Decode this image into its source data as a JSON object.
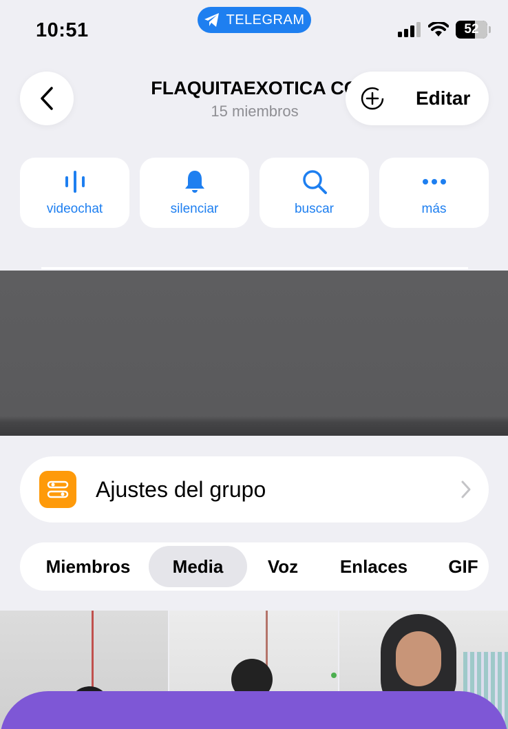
{
  "status_bar": {
    "time": "10:51",
    "telegram_pill": "TELEGRAM",
    "battery": "52"
  },
  "header": {
    "title": "FLAQUITAEXOTICA CO",
    "subtitle": "15 miembros",
    "edit_label": "Editar"
  },
  "actions": [
    {
      "label": "videochat",
      "icon": "voice-chat-icon"
    },
    {
      "label": "silenciar",
      "icon": "bell-icon"
    },
    {
      "label": "buscar",
      "icon": "search-icon"
    },
    {
      "label": "más",
      "icon": "more-icon"
    }
  ],
  "settings": {
    "label": "Ajustes del grupo"
  },
  "tabs": [
    {
      "label": "Miembros",
      "active": false
    },
    {
      "label": "Media",
      "active": true
    },
    {
      "label": "Voz",
      "active": false
    },
    {
      "label": "Enlaces",
      "active": false
    },
    {
      "label": "GIF",
      "active": false
    }
  ],
  "colors": {
    "accent": "#1e7ff0",
    "settings_icon": "#fe9a0a",
    "overlay": "#7e57d6"
  }
}
